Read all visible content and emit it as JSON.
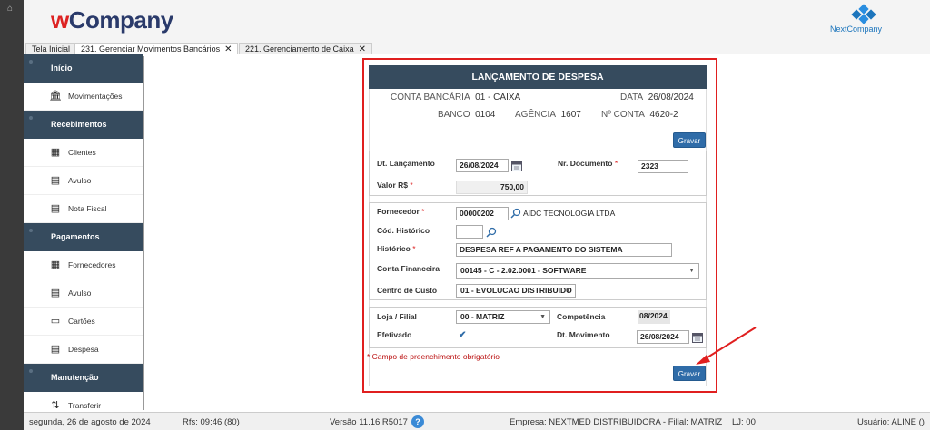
{
  "app": {
    "logo_w": "w",
    "logo_rest": "Company",
    "brand_right": "NextCompany",
    "accent": "#364b5e",
    "button_color": "#2f6ca8",
    "highlight": "#e01f1f"
  },
  "tabs": [
    {
      "label": "Tela Inicial"
    },
    {
      "label": "231. Gerenciar Movimentos Bancários",
      "close": "✕"
    },
    {
      "label": "221. Gerenciamento de Caixa",
      "close": "✕"
    }
  ],
  "sidebar": {
    "inicio": "Início",
    "movimentacoes": "Movimentações",
    "recebimentos": "Recebimentos",
    "clientes": "Clientes",
    "avulso1": "Avulso",
    "nota_fiscal": "Nota Fiscal",
    "pagamentos": "Pagamentos",
    "fornecedores": "Fornecedores",
    "avulso2": "Avulso",
    "cartoes": "Cartões",
    "despesa": "Despesa",
    "manutencao": "Manutenção",
    "transferir": "Transferir"
  },
  "form": {
    "title": "LANÇAMENTO DE DESPESA",
    "conta_label": "CONTA BANCÁRIA",
    "conta_value": "01 - CAIXA",
    "data_label": "DATA",
    "data_value": "26/08/2024",
    "banco_label": "BANCO",
    "banco_value": "0104",
    "agencia_label": "AGÊNCIA",
    "agencia_value": "1607",
    "nconta_label": "Nº CONTA",
    "nconta_value": "4620-2",
    "gravar": "Gravar",
    "dt_lancamento_label": "Dt. Lançamento",
    "dt_lancamento": "26/08/2024",
    "nr_documento_label": "Nr. Documento",
    "nr_documento": "2323",
    "valor_label": "Valor R$",
    "valor": "750,00",
    "fornecedor_label": "Fornecedor",
    "fornecedor_code": "00000202",
    "fornecedor_name": "AIDC TECNOLOGIA LTDA",
    "cod_historico_label": "Cód. Histórico",
    "cod_historico": "",
    "historico_label": "Histórico",
    "historico": "DESPESA REF A PAGAMENTO DO SISTEMA",
    "conta_financeira_label": "Conta Financeira",
    "conta_financeira": "00145 - C - 2.02.0001 - SOFTWARE",
    "centro_custo_label": "Centro de Custo",
    "centro_custo": "01 - EVOLUCAO DISTRIBUIDO",
    "loja_label": "Loja / Filial",
    "loja": "00 - MATRIZ",
    "competencia_label": "Competência",
    "competencia": "08/2024",
    "efetivado_label": "Efetivado",
    "efetivado_check": "✔",
    "dt_movimento_label": "Dt. Movimento",
    "dt_movimento": "26/08/2024",
    "required_mark": "*",
    "required_note": "* Campo de preenchimento obrigatório"
  },
  "status": {
    "date": "segunda, 26 de agosto de 2024",
    "rfs": "Rfs: 09:46 (80)",
    "version": "Versão 11.16.R5017",
    "help": "?",
    "company": "Empresa: NEXTMED DISTRIBUIDORA - Filial: MATRIZ",
    "lj": "LJ: 00",
    "user": "Usuário: ALINE ()"
  }
}
